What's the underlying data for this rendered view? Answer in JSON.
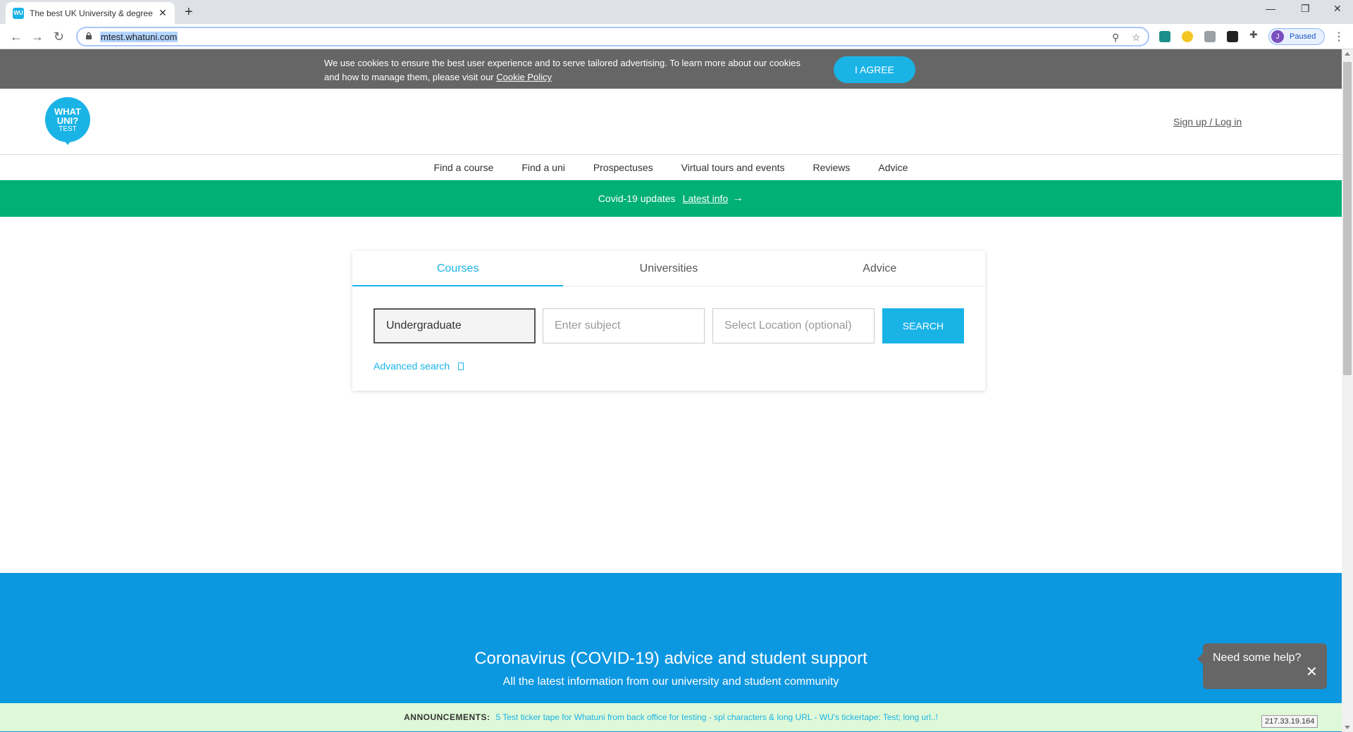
{
  "browser": {
    "tab_title": "The best UK University & degree",
    "tab_favicon": "WU",
    "url": "mtest.whatuni.com",
    "profile_initial": "J",
    "profile_status": "Paused"
  },
  "cookie_banner": {
    "text": "We use cookies to ensure the best user experience and to serve tailored advertising. To learn more about our cookies and how to manage them, please visit our",
    "link": "Cookie Policy",
    "agree_label": "I AGREE"
  },
  "header": {
    "logo_line1": "WHAT",
    "logo_line2": "UNI?",
    "logo_line3": "TEST",
    "signup_label": "Sign up / Log in"
  },
  "nav": {
    "items": [
      "Find a course",
      "Find a uni",
      "Prospectuses",
      "Virtual tours and events",
      "Reviews",
      "Advice"
    ]
  },
  "covid_bar": {
    "text": "Covid-19 updates",
    "link": "Latest info"
  },
  "search": {
    "tabs": [
      "Courses",
      "Universities",
      "Advice"
    ],
    "study_level": "Undergraduate",
    "subject_placeholder": "Enter subject",
    "location_placeholder": "Select Location (optional)",
    "search_label": "SEARCH",
    "advanced_label": "Advanced search"
  },
  "covid_section": {
    "title": "Coronavirus (COVID-19) advice and student support",
    "subtitle": "All the latest information from our university and student community"
  },
  "help_widget": {
    "text": "Need some help?"
  },
  "announcements": {
    "label": "ANNOUNCEMENTS:",
    "text": "5 Test ticker tape for Whatuni from back office for testing - spl characters & long URL - WU's tickertape: Test; long url..!"
  },
  "status": {
    "ip": "217.33.19.164"
  },
  "colors": {
    "brand_blue": "#1ab3e6",
    "covid_green": "#00b074",
    "section_blue": "#0c97e1",
    "cookie_gray": "#666666"
  }
}
